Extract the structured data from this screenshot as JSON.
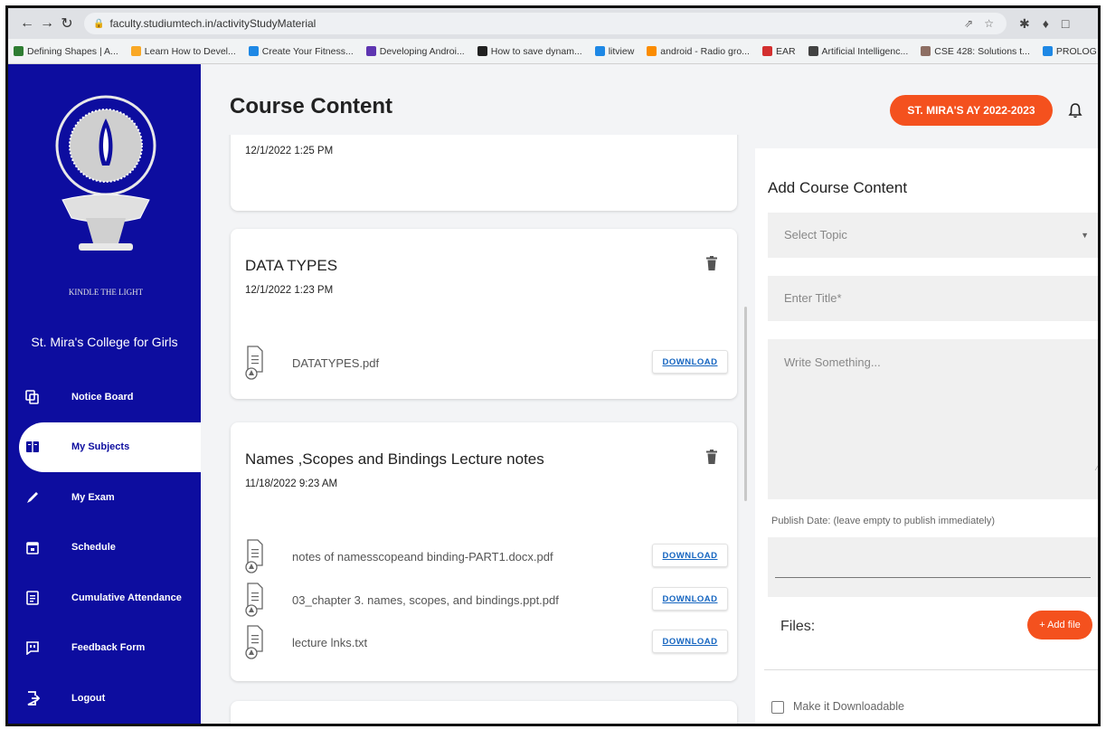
{
  "browser": {
    "url": "faculty.studiumtech.in/activityStudyMaterial",
    "bookmarks": [
      {
        "label": "Defining Shapes | A...",
        "color": "#2e7d32"
      },
      {
        "label": "Learn How to Devel...",
        "color": "#f9a825"
      },
      {
        "label": "Create Your Fitness...",
        "color": "#1e88e5"
      },
      {
        "label": "Developing Androi...",
        "color": "#5e35b1"
      },
      {
        "label": "How to save dynam...",
        "color": "#212121"
      },
      {
        "label": "litview",
        "color": "#1e88e5"
      },
      {
        "label": "android - Radio gro...",
        "color": "#fb8c00"
      },
      {
        "label": "EAR",
        "color": "#d32f2f"
      },
      {
        "label": "Artificial Intelligenc...",
        "color": "#424242"
      },
      {
        "label": "CSE 428: Solutions t...",
        "color": "#8d6e63"
      },
      {
        "label": "PROLOG",
        "color": "#1e88e5"
      }
    ]
  },
  "sidebar": {
    "motto": "KINDLE THE LIGHT",
    "college_name": "St. Mira's College for Girls",
    "items": [
      {
        "label": "Notice Board",
        "icon": "notice-board-icon"
      },
      {
        "label": "My Subjects",
        "icon": "book-icon"
      },
      {
        "label": "My Exam",
        "icon": "pencil-icon"
      },
      {
        "label": "Schedule",
        "icon": "calendar-icon"
      },
      {
        "label": "Cumulative Attendance",
        "icon": "attendance-icon"
      },
      {
        "label": "Feedback Form",
        "icon": "feedback-icon"
      },
      {
        "label": "Logout",
        "icon": "logout-icon"
      }
    ],
    "active_index": 1
  },
  "header": {
    "title": "Course Content",
    "year_badge": "ST. MIRA'S AY 2022-2023"
  },
  "cards": [
    {
      "title": "",
      "date": "12/1/2022 1:25 PM",
      "files": []
    },
    {
      "title": "DATA TYPES",
      "date": "12/1/2022 1:23 PM",
      "files": [
        {
          "name": "DATATYPES.pdf",
          "action": "DOWNLOAD"
        }
      ]
    },
    {
      "title": "Names ,Scopes and Bindings Lecture notes",
      "date": "11/18/2022 9:23 AM",
      "files": [
        {
          "name": "notes of namesscopeand binding-PART1.docx.pdf",
          "action": "DOWNLOAD"
        },
        {
          "name": "03_chapter 3. names, scopes, and bindings.ppt.pdf",
          "action": "DOWNLOAD"
        },
        {
          "name": "lecture lnks.txt",
          "action": "DOWNLOAD"
        }
      ]
    }
  ],
  "form": {
    "title": "Add Course Content",
    "topic_placeholder": "Select Topic",
    "title_placeholder": "Enter Title*",
    "body_placeholder": "Write Something...",
    "publish_label": "Publish Date: (leave empty to publish immediately)",
    "files_label": "Files:",
    "add_file_label": "+ Add file",
    "downloadable_label": "Make it Downloadable"
  },
  "colors": {
    "sidebar": "#0d0d9f",
    "accent": "#f4511e",
    "link": "#1565c0"
  }
}
